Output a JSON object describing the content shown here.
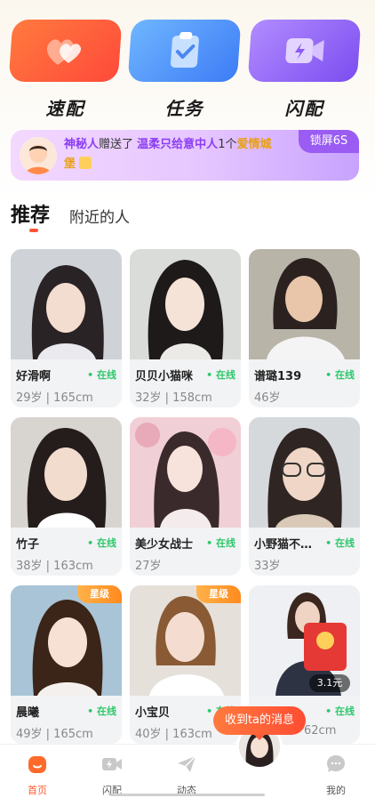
{
  "top_actions": [
    {
      "label": "速配",
      "icon": "hearts-icon"
    },
    {
      "label": "任务",
      "icon": "clipboard-check-icon"
    },
    {
      "label": "闪配",
      "icon": "flash-video-icon"
    }
  ],
  "banner": {
    "sender": "神秘人",
    "verb": "赠送了",
    "recipient": "温柔只给意中人",
    "count": "1个",
    "gift": "爱情城",
    "gift_cont": "堡",
    "lock_label": "锁屏6S"
  },
  "tabs": {
    "active": "推荐",
    "other": "附近的人"
  },
  "cards": [
    {
      "name": "好滑啊",
      "status": "• 在线",
      "meta": "29岁 | 165cm",
      "badge": ""
    },
    {
      "name": "贝贝小猫咪",
      "status": "• 在线",
      "meta": "32岁 | 158cm",
      "badge": ""
    },
    {
      "name": "谱璐139",
      "status": "• 在线",
      "meta": "46岁",
      "badge": ""
    },
    {
      "name": "竹子",
      "status": "• 在线",
      "meta": "38岁 | 163cm",
      "badge": ""
    },
    {
      "name": "美少女战士",
      "status": "• 在线",
      "meta": "27岁",
      "badge": ""
    },
    {
      "name": "小野猫不…",
      "status": "• 在线",
      "meta": "33岁",
      "badge": ""
    },
    {
      "name": "晨曦",
      "status": "• 在线",
      "meta": "49岁 | 165cm",
      "badge": "星级"
    },
    {
      "name": "小宝贝",
      "status": "• 在线",
      "meta": "40岁 | 163cm",
      "badge": "星级"
    },
    {
      "name": "",
      "status": "• 在线",
      "meta": "62cm",
      "badge": "",
      "redpack": "3.1元"
    }
  ],
  "toast": "收到ta的消息",
  "tabbar": [
    {
      "label": "首页",
      "icon": "home-icon",
      "active": true
    },
    {
      "label": "闪配",
      "icon": "video-flash-icon",
      "active": false
    },
    {
      "label": "动态",
      "icon": "paper-plane-icon",
      "active": false
    },
    {
      "label": "",
      "icon": "avatar",
      "active": false
    },
    {
      "label": "我的",
      "icon": "chat-bubble-icon",
      "active": false
    }
  ],
  "colors": {
    "accent": "#ff5a2a",
    "online": "#2cc86a",
    "purple": "#8b3df2"
  }
}
